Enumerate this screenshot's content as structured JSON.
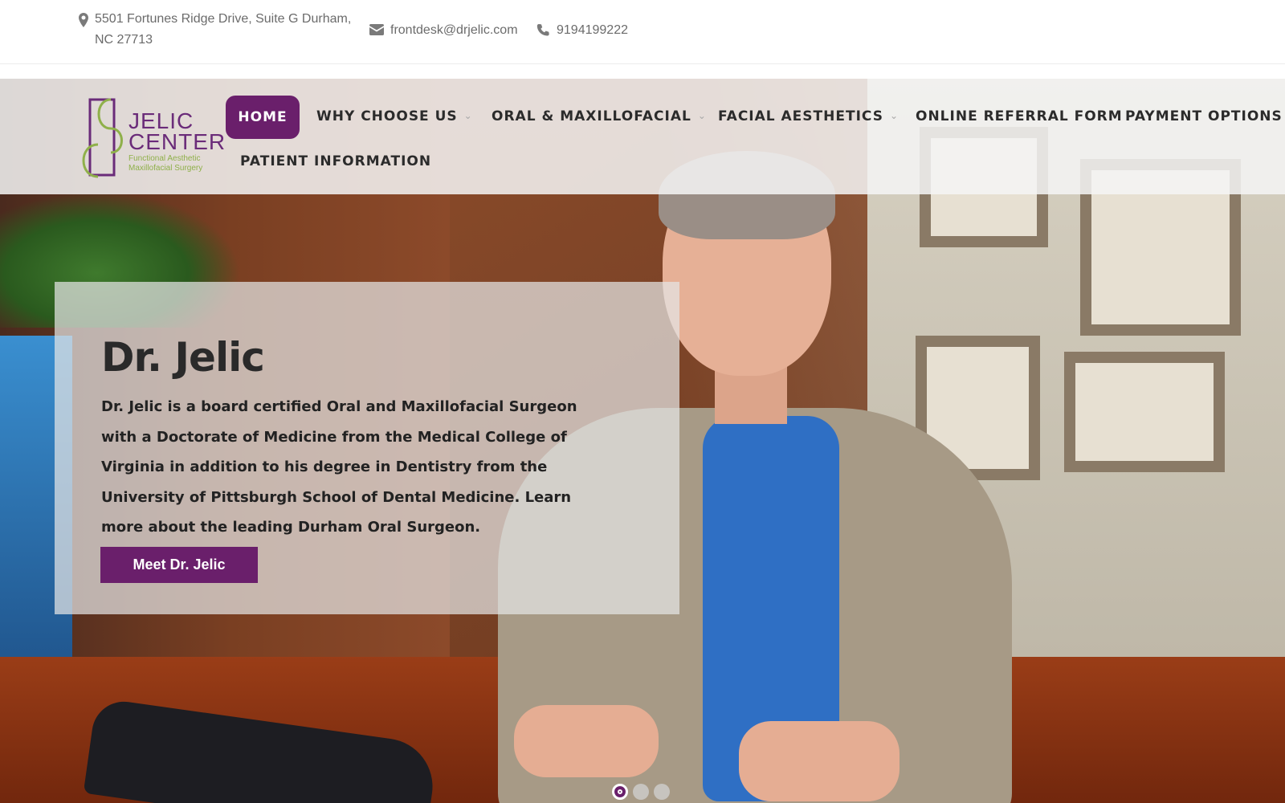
{
  "contact": {
    "address_line1": "5501 Fortunes Ridge Drive, Suite G Durham,",
    "address_line2": "NC 27713",
    "email": "frontdesk@drjelic.com",
    "phone": "9194199222",
    "icons": [
      "map-marker-icon",
      "envelope-icon",
      "phone-icon"
    ]
  },
  "logo": {
    "line1": "JELIC",
    "line2": "CENTER",
    "tagline1": "Functional Aesthetic",
    "tagline2": "Maxillofacial Surgery"
  },
  "nav": {
    "home": "HOME",
    "why": "WHY CHOOSE US",
    "oral": "ORAL & MAXILLOFACIAL",
    "facial": "FACIAL AESTHETICS",
    "referral": "ONLINE REFERRAL FORM",
    "payment": "PAYMENT OPTIONS",
    "patient": "PATIENT INFORMATION"
  },
  "hero": {
    "title": "Dr. Jelic",
    "body": "Dr. Jelic is a board certified Oral and Maxillofacial Surgeon with a Doctorate of Medicine from the Medical College of Virginia in addition to his degree in Dentistry from the University of Pittsburgh School of Dental Medicine. Learn more about the leading Durham Oral Surgeon.",
    "cta": "Meet Dr. Jelic"
  },
  "slider": {
    "count": 3,
    "active_index": 0
  },
  "colors": {
    "brand": "#6a1f6b",
    "accent_green": "#8fb04a"
  }
}
